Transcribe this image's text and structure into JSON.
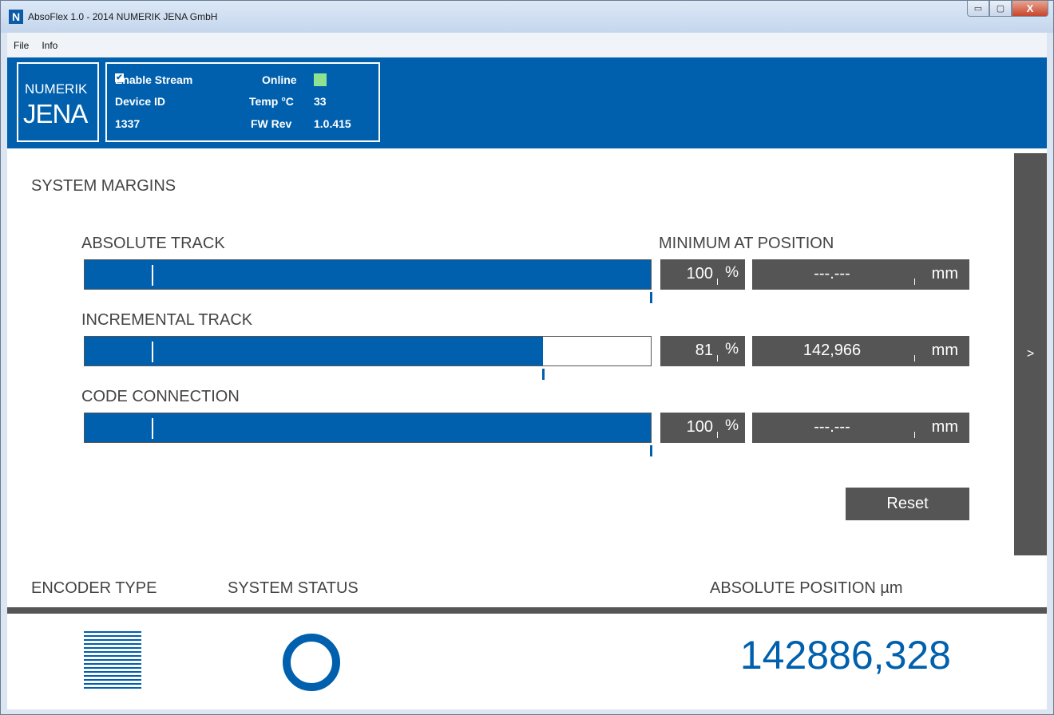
{
  "window": {
    "title": "AbsoFlex 1.0 - 2014 NUMERIK JENA GmbH",
    "app_icon_letter": "N",
    "min_glyph": "▭",
    "max_glyph": "▢",
    "close_glyph": "X"
  },
  "menu": {
    "items": [
      "File",
      "Info"
    ]
  },
  "header": {
    "logo_line1": "NUMERIK",
    "logo_line2": "JENA",
    "enable_stream_label": "Enable Stream",
    "enable_stream_checked": true,
    "online_label": "Online",
    "online_color": "#8fe28f",
    "device_id_label": "Device ID",
    "device_id_value": "1337",
    "temp_label": "Temp °C",
    "temp_value": "33",
    "fw_label": "FW Rev",
    "fw_value": "1.0.415"
  },
  "margins": {
    "title": "SYSTEM MARGINS",
    "min_position_header": "MINIMUM AT POSITION",
    "pct_unit": "%",
    "pos_unit": "mm",
    "tracks": [
      {
        "label": "ABSOLUTE TRACK",
        "percent": "100",
        "fill_fraction": 1.0,
        "position": "---.---"
      },
      {
        "label": "INCREMENTAL TRACK",
        "percent": "81",
        "fill_fraction": 0.81,
        "position": "142,966"
      },
      {
        "label": "CODE CONNECTION",
        "percent": "100",
        "fill_fraction": 1.0,
        "position": "---.---"
      }
    ],
    "reset_label": "Reset"
  },
  "side_toggle_label": ">",
  "bottom": {
    "encoder_type_label": "ENCODER TYPE",
    "system_status_label": "SYSTEM STATUS",
    "absolute_position_label": "ABSOLUTE POSITION µm",
    "absolute_position_value": "142886,328"
  },
  "colors": {
    "brand_blue": "#0060ad",
    "panel_gray": "#555555"
  }
}
